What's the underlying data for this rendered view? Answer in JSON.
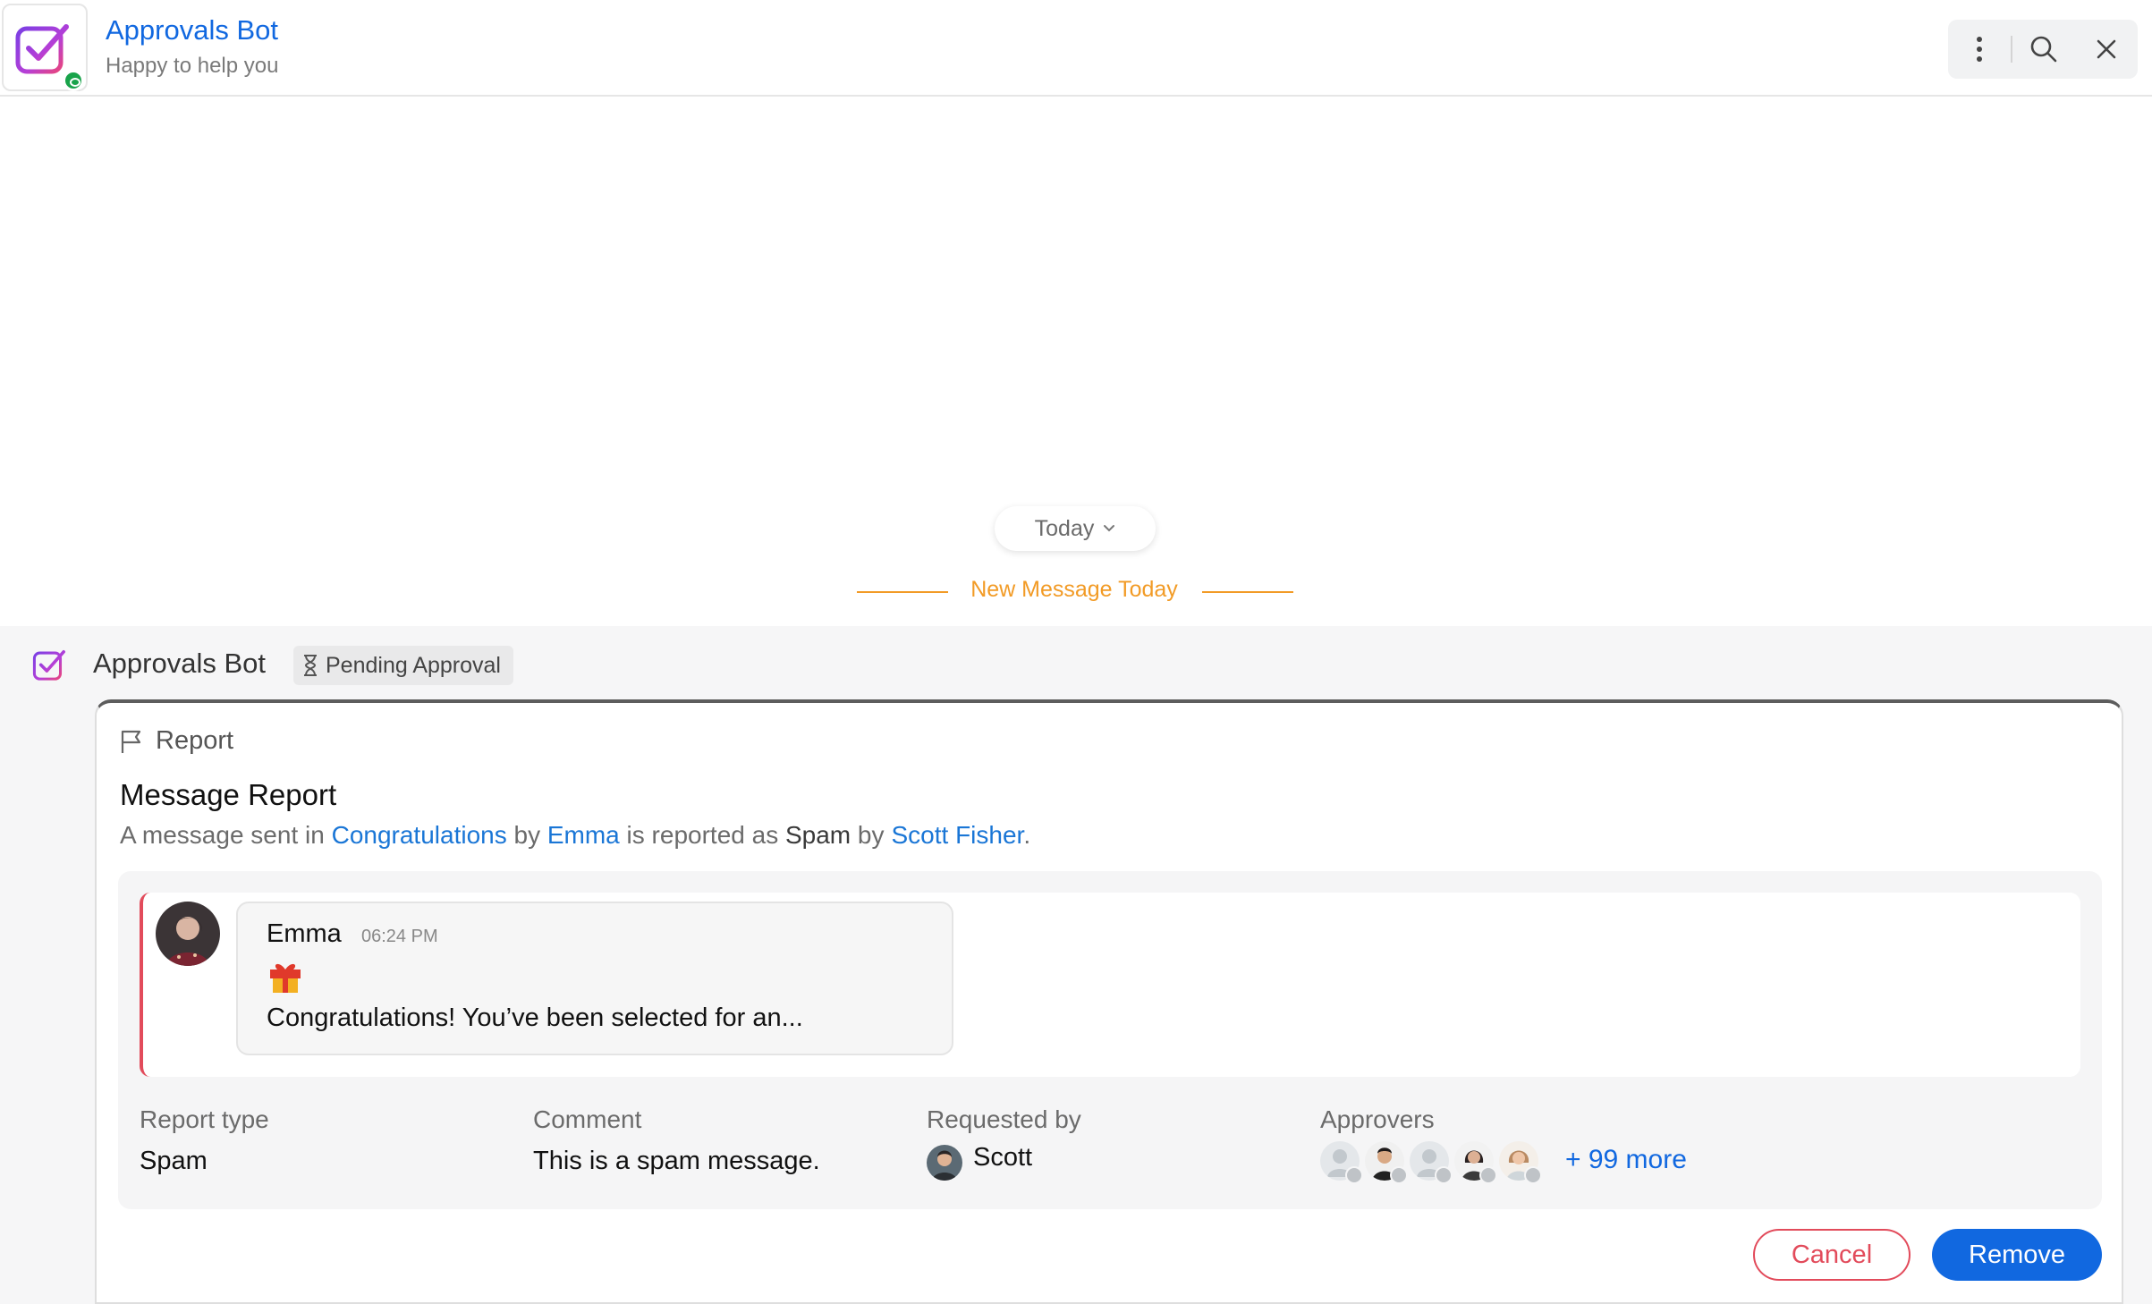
{
  "header": {
    "title": "Approvals Bot",
    "subtitle": "Happy to help you",
    "actions": [
      "more-options",
      "search",
      "close"
    ]
  },
  "timeline": {
    "date_chip": "Today",
    "new_message_label": "New Message Today"
  },
  "message": {
    "sender": "Approvals Bot",
    "status": "Pending Approval",
    "card": {
      "tag": "Report",
      "title": "Message Report",
      "description": {
        "prefix": "A message sent in",
        "channel": "Congratulations",
        "by1": "by",
        "author": "Emma",
        "middle": "is reported as",
        "report_type": "Spam",
        "by2": "by",
        "reporter": "Scott Fisher",
        "suffix": "."
      },
      "quoted_message": {
        "author": "Emma",
        "time": "06:24 PM",
        "emoji": "gift",
        "text": "Congratulations! You’ve been selected for an..."
      },
      "meta": {
        "report_type_label": "Report type",
        "report_type_value": "Spam",
        "comment_label": "Comment",
        "comment_value": "This is a spam message.",
        "requested_by_label": "Requested by",
        "requested_by_value": "Scott",
        "approvers_label": "Approvers",
        "approvers_more": "+ 99 more"
      },
      "buttons": {
        "cancel": "Cancel",
        "remove": "Remove"
      }
    }
  },
  "colors": {
    "accent": "#1168e0",
    "link": "#1a76d6",
    "new_message": "#f29b26",
    "danger": "#e24b5b",
    "online": "#18a34a"
  }
}
